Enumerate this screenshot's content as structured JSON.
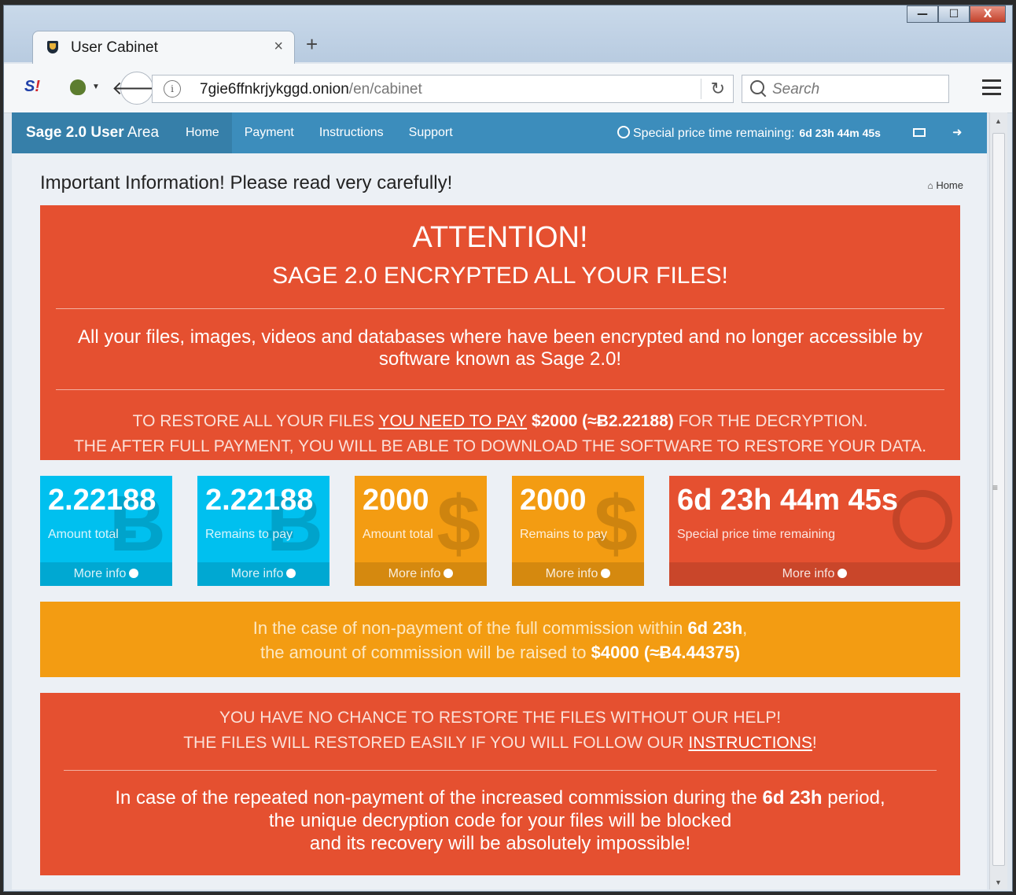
{
  "browser": {
    "tab_title": "User Cabinet",
    "tab_close": "×",
    "new_tab": "+",
    "url_domain": "7gie6ffnkrjykggd.onion",
    "url_path": "/en/cabinet",
    "search_placeholder": "Search",
    "window_buttons": {
      "minimize": "—",
      "maximize": "☐",
      "close": "X"
    }
  },
  "app": {
    "brand_bold": "Sage 2.0 User",
    "brand_light": " Area",
    "nav": [
      "Home",
      "Payment",
      "Instructions",
      "Support"
    ],
    "timer_label": "Special price time remaining:",
    "timer_value": "6d 23h 44m 45s",
    "page_heading": "Important Information! Please read very carefully!",
    "breadcrumb": "Home"
  },
  "attention": {
    "title": "ATTENTION!",
    "subtitle": "SAGE 2.0 ENCRYPTED ALL YOUR FILES!",
    "body": "All your files, images, videos and databases where have been encrypted and no longer accessible by software known as Sage 2.0!",
    "restore_pre": "TO RESTORE ALL YOUR FILES ",
    "restore_link": "YOU NEED TO PAY",
    "restore_amount": " $2000 (≈Ƀ2.22188)",
    "restore_post": " FOR THE DECRYPTION.",
    "restore_line2": "THE AFTER FULL PAYMENT, YOU WILL BE ABLE TO DOWNLOAD THE SOFTWARE TO RESTORE YOUR DATA."
  },
  "tiles": [
    {
      "value": "2.22188",
      "label": "Amount total",
      "more": "More info",
      "symbol": "Ƀ"
    },
    {
      "value": "2.22188",
      "label": "Remains to pay",
      "more": "More info",
      "symbol": "Ƀ"
    },
    {
      "value": "2000",
      "label": "Amount total",
      "more": "More info",
      "symbol": "$"
    },
    {
      "value": "2000",
      "label": "Remains to pay",
      "more": "More info",
      "symbol": "$"
    },
    {
      "value": "6d 23h 44m 45s",
      "label": "Special price time remaining",
      "more": "More info",
      "symbol": "clock-icon"
    }
  ],
  "commission": {
    "line1_pre": "In the case of non-payment of the full commission within ",
    "line1_bold": "6d 23h",
    "line1_post": ",",
    "line2_pre": "the amount of commission will be raised to ",
    "line2_bold": "$4000 (≈Ƀ4.44375)"
  },
  "warning": {
    "line1": "YOU HAVE NO CHANCE TO RESTORE THE FILES WITHOUT OUR HELP!",
    "line2_pre": "THE FILES WILL RESTORED EASILY IF YOU WILL FOLLOW OUR ",
    "line2_link": "INSTRUCTIONS",
    "line2_post": "!",
    "final_pre": "In case of the repeated non-payment of the increased commission during the ",
    "final_bold": "6d 23h",
    "final_post": " period,",
    "final_line2": "the unique decryption code for your files will be blocked",
    "final_line3": "and its recovery will be absolutely impossible!"
  },
  "colors": {
    "red": "#e55030",
    "orange": "#f39c12",
    "blue": "#00c0ef",
    "navbar": "#3c8dbc"
  }
}
